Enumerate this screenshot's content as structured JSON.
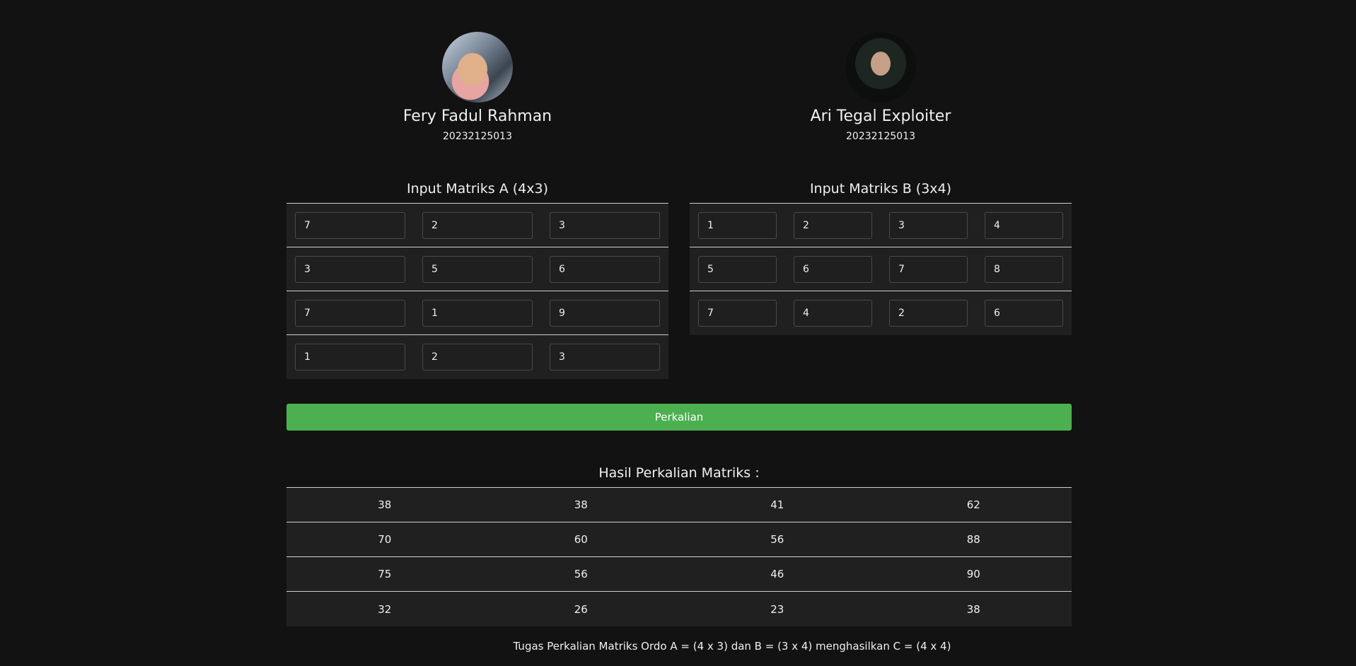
{
  "profiles": [
    {
      "name": "Fery Fadul Rahman",
      "nim": "20232125013"
    },
    {
      "name": "Ari Tegal Exploiter",
      "nim": "20232125013"
    }
  ],
  "matrixA": {
    "title": "Input Matriks A (4x3)",
    "rows": [
      [
        "7",
        "2",
        "3"
      ],
      [
        "3",
        "5",
        "6"
      ],
      [
        "7",
        "1",
        "9"
      ],
      [
        "1",
        "2",
        "3"
      ]
    ]
  },
  "matrixB": {
    "title": "Input Matriks B (3x4)",
    "rows": [
      [
        "1",
        "2",
        "3",
        "4"
      ],
      [
        "5",
        "6",
        "7",
        "8"
      ],
      [
        "7",
        "4",
        "2",
        "6"
      ]
    ]
  },
  "button": {
    "label": "Perkalian",
    "color": "#4caf50"
  },
  "result": {
    "title": "Hasil Perkalian Matriks :",
    "rows": [
      [
        "38",
        "38",
        "41",
        "62"
      ],
      [
        "70",
        "60",
        "56",
        "88"
      ],
      [
        "75",
        "56",
        "46",
        "90"
      ],
      [
        "32",
        "26",
        "23",
        "38"
      ]
    ]
  },
  "footer": "Tugas Perkalian Matriks Ordo A = (4 x 3) dan B = (3 x 4) menghasilkan C = (4 x 4)"
}
